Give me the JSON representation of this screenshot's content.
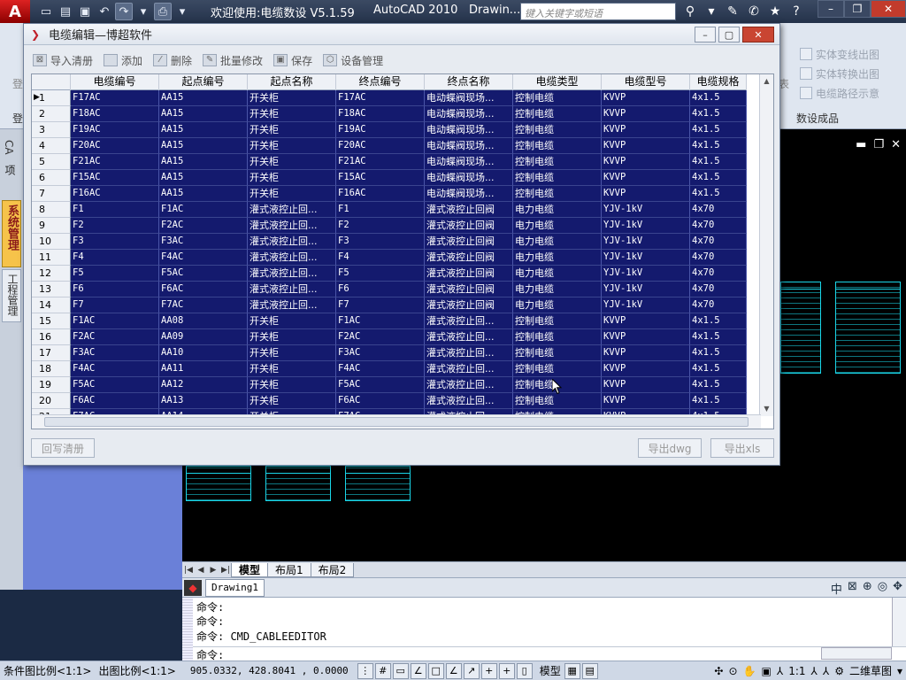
{
  "app": {
    "logo": "A",
    "title": "欢迎使用:电缆数设 V5.1.59",
    "product": "AutoCAD 2010",
    "doc": "Drawin...",
    "search_placeholder": "键入关键字或短语"
  },
  "ribbon": {
    "right_items": [
      "实体变线出图",
      "实体转换出图",
      "电缆路径示意"
    ],
    "right_panel_label": "数设成品",
    "left_label": "登",
    "left_label2": "登",
    "biao": "表"
  },
  "left_palette": {
    "cad_label": "CA",
    "item_label": "项",
    "active_tab": "系统管理",
    "tab2": "工程管理"
  },
  "dialog": {
    "title": "电缆编辑—博超软件",
    "toolbar": {
      "import": "导入清册",
      "add": "添加",
      "delete": "删除",
      "batch": "批量修改",
      "save": "保存",
      "device": "设备管理"
    },
    "columns": [
      "电缆编号",
      "起点编号",
      "起点名称",
      "终点编号",
      "终点名称",
      "电缆类型",
      "电缆型号",
      "电缆规格"
    ],
    "rows": [
      [
        "1",
        "F17AC",
        "AA15",
        "开关柜",
        "F17AC",
        "电动蝶阀现场...",
        "控制电缆",
        "KVVP",
        "4x1.5"
      ],
      [
        "2",
        "F18AC",
        "AA15",
        "开关柜",
        "F18AC",
        "电动蝶阀现场...",
        "控制电缆",
        "KVVP",
        "4x1.5"
      ],
      [
        "3",
        "F19AC",
        "AA15",
        "开关柜",
        "F19AC",
        "电动蝶阀现场...",
        "控制电缆",
        "KVVP",
        "4x1.5"
      ],
      [
        "4",
        "F20AC",
        "AA15",
        "开关柜",
        "F20AC",
        "电动蝶阀现场...",
        "控制电缆",
        "KVVP",
        "4x1.5"
      ],
      [
        "5",
        "F21AC",
        "AA15",
        "开关柜",
        "F21AC",
        "电动蝶阀现场...",
        "控制电缆",
        "KVVP",
        "4x1.5"
      ],
      [
        "6",
        "F15AC",
        "AA15",
        "开关柜",
        "F15AC",
        "电动蝶阀现场...",
        "控制电缆",
        "KVVP",
        "4x1.5"
      ],
      [
        "7",
        "F16AC",
        "AA15",
        "开关柜",
        "F16AC",
        "电动蝶阀现场...",
        "控制电缆",
        "KVVP",
        "4x1.5"
      ],
      [
        "8",
        "F1",
        "F1AC",
        "灌式液控止回...",
        "F1",
        "灌式液控止回阀",
        "电力电缆",
        "YJV-1kV",
        "4x70"
      ],
      [
        "9",
        "F2",
        "F2AC",
        "灌式液控止回...",
        "F2",
        "灌式液控止回阀",
        "电力电缆",
        "YJV-1kV",
        "4x70"
      ],
      [
        "10",
        "F3",
        "F3AC",
        "灌式液控止回...",
        "F3",
        "灌式液控止回阀",
        "电力电缆",
        "YJV-1kV",
        "4x70"
      ],
      [
        "11",
        "F4",
        "F4AC",
        "灌式液控止回...",
        "F4",
        "灌式液控止回阀",
        "电力电缆",
        "YJV-1kV",
        "4x70"
      ],
      [
        "12",
        "F5",
        "F5AC",
        "灌式液控止回...",
        "F5",
        "灌式液控止回阀",
        "电力电缆",
        "YJV-1kV",
        "4x70"
      ],
      [
        "13",
        "F6",
        "F6AC",
        "灌式液控止回...",
        "F6",
        "灌式液控止回阀",
        "电力电缆",
        "YJV-1kV",
        "4x70"
      ],
      [
        "14",
        "F7",
        "F7AC",
        "灌式液控止回...",
        "F7",
        "灌式液控止回阀",
        "电力电缆",
        "YJV-1kV",
        "4x70"
      ],
      [
        "15",
        "F1AC",
        "AA08",
        "开关柜",
        "F1AC",
        "灌式液控止回...",
        "控制电缆",
        "KVVP",
        "4x1.5"
      ],
      [
        "16",
        "F2AC",
        "AA09",
        "开关柜",
        "F2AC",
        "灌式液控止回...",
        "控制电缆",
        "KVVP",
        "4x1.5"
      ],
      [
        "17",
        "F3AC",
        "AA10",
        "开关柜",
        "F3AC",
        "灌式液控止回...",
        "控制电缆",
        "KVVP",
        "4x1.5"
      ],
      [
        "18",
        "F4AC",
        "AA11",
        "开关柜",
        "F4AC",
        "灌式液控止回...",
        "控制电缆",
        "KVVP",
        "4x1.5"
      ],
      [
        "19",
        "F5AC",
        "AA12",
        "开关柜",
        "F5AC",
        "灌式液控止回...",
        "控制电缆",
        "KVVP",
        "4x1.5"
      ],
      [
        "20",
        "F6AC",
        "AA13",
        "开关柜",
        "F6AC",
        "灌式液控止回...",
        "控制电缆",
        "KVVP",
        "4x1.5"
      ],
      [
        "21",
        "F7AC",
        "AA14",
        "开关柜",
        "F7AC",
        "灌式液控止回...",
        "控制电缆",
        "KVVP",
        "4x1.5"
      ]
    ],
    "buttons": {
      "write_back": "回写清册",
      "export_dwg": "导出dwg",
      "export_xls": "导出xls"
    }
  },
  "layout_tabs": [
    "模型",
    "布局1",
    "布局2"
  ],
  "doc_tab": "Drawing1",
  "command_lines": [
    "命令:",
    "命令:",
    "命令: CMD_CABLEEDITOR"
  ],
  "command_prompt": "命令:",
  "status": {
    "cond_scale": "条件图比例<1:1>",
    "out_scale": "出图比例<1:1>",
    "coords": "905.0332, 428.8041 , 0.0000",
    "model": "模型",
    "anno_scale": "1:1",
    "workspace": "二维草图"
  },
  "colors": {
    "grid_bg": "#141a6e",
    "dialog_bg": "#e7ebf1",
    "acad_title": "#24324a"
  }
}
